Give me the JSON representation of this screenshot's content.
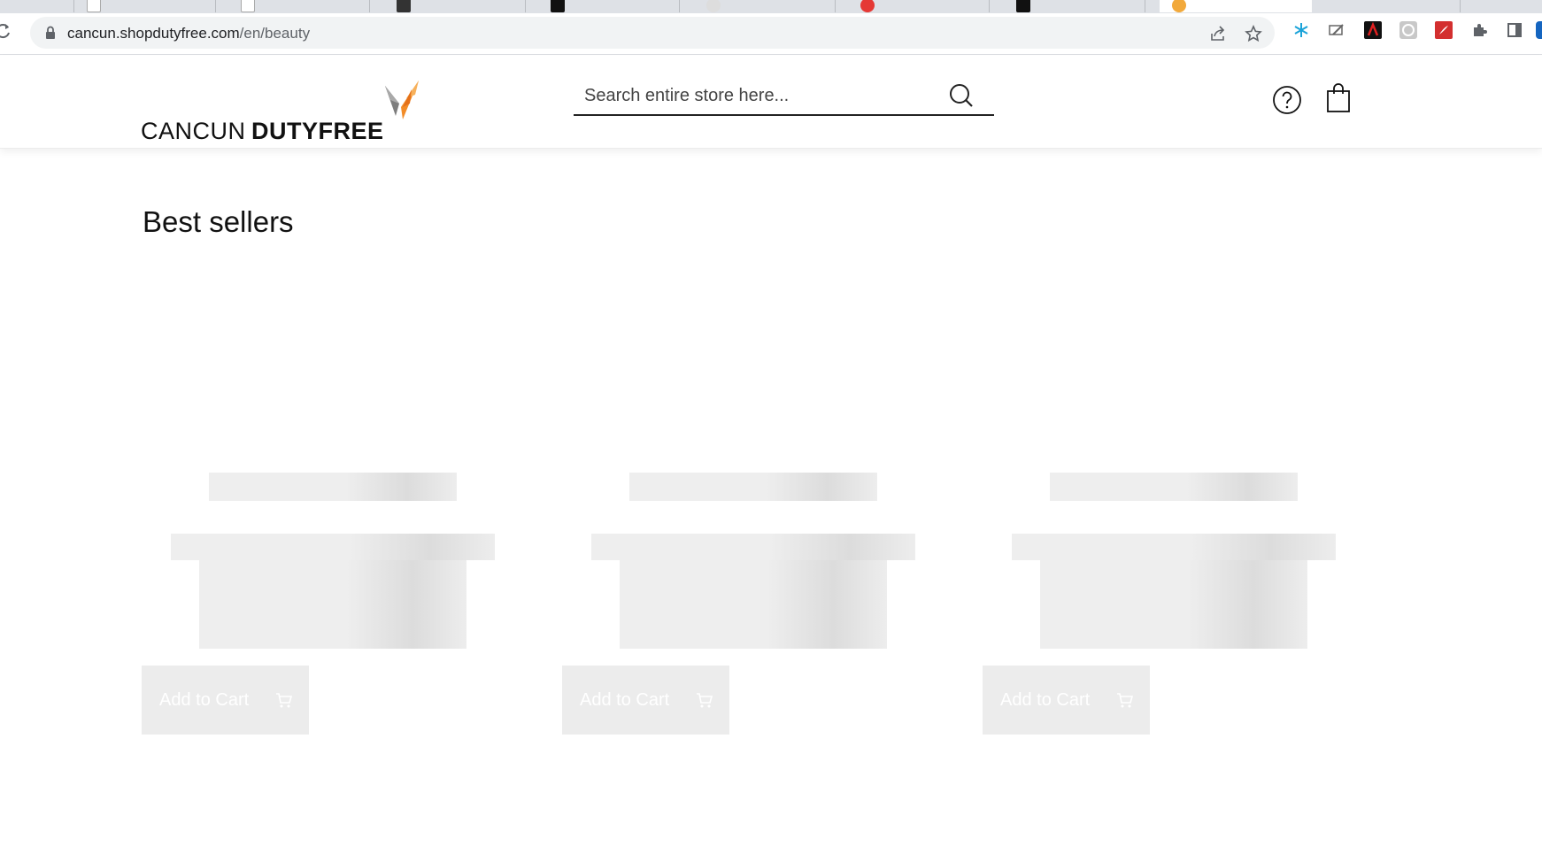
{
  "browser": {
    "url_host": "cancun.shopdutyfree.com",
    "url_path": "/en/beauty"
  },
  "header": {
    "logo_light": "CANCUN",
    "logo_bold": "DUTYFREE",
    "search_placeholder": "Search entire store here..."
  },
  "main": {
    "section_title": "Best sellers",
    "products": [
      {
        "add_label": "Add to Cart"
      },
      {
        "add_label": "Add to Cart"
      },
      {
        "add_label": "Add to Cart"
      }
    ]
  },
  "colors": {
    "brand_orange": "#f28c28",
    "skeleton": "#eeeeee",
    "button_disabled": "#ececec"
  }
}
